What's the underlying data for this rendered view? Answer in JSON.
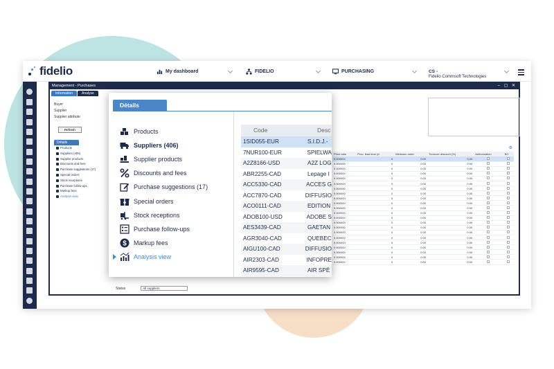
{
  "app": {
    "logo": "fidelio"
  },
  "topnav": {
    "dashboard": "My dashboard",
    "module": "FIDELIO",
    "purchasing": "PURCHASING",
    "user_code": "CS -",
    "user_company": "Fidelio Commsoft Technologies"
  },
  "window": {
    "title": "Management - Purchases",
    "tabs": [
      "Information",
      "Analyse"
    ],
    "filters": [
      "Buyer",
      "Supplier",
      "Supplier attribute"
    ],
    "refresh_label": "Refresh",
    "status_label": "Status",
    "status_value": "All suppliers"
  },
  "details": {
    "tab_label": "Détails",
    "items": [
      "Products",
      "Suppliers (406)",
      "Supplier products",
      "Discounts and fees",
      "Purchase suggestions (17)",
      "Special orders",
      "Stock receptions",
      "Purchase follow-ups",
      "Markup fees",
      "Analysis view"
    ]
  },
  "supplier_table": {
    "headers": [
      "Code",
      "Desc"
    ],
    "rows": [
      [
        "1SID055-EUR",
        "S.I.D.J.-"
      ],
      [
        "7NUR100-EUR",
        "SPIELWA"
      ],
      [
        "A2Z8166-USD",
        "A2Z LOG"
      ],
      [
        "ABR2255-CAD",
        "Lepage I"
      ],
      [
        "ACC5330-CAD",
        "ACCES G"
      ],
      [
        "ACC7870-CAD",
        "DIFFUSIO"
      ],
      [
        "ACO0111-CAD",
        "EDITION"
      ],
      [
        "ADOB100-USD",
        "ADOBE S"
      ],
      [
        "AES3439-CAD",
        "GAETAN"
      ],
      [
        "AGR3040-CAD",
        "QUEBEC"
      ],
      [
        "AIGU100-CAD",
        "DIFFUSIO"
      ],
      [
        "AIR2303-CAD",
        "INFOPRE"
      ],
      [
        "AIR9595-CAD",
        "AIR SPÉ"
      ]
    ]
  },
  "analysis_grid": {
    "headers": [
      "Price ratio",
      "Proc. lead time (d",
      "Minimum order",
      "Turnover discount (%)",
      "Authorization",
      "BO"
    ],
    "ratio": "0.000000",
    "lead": "0",
    "amount": "0.00",
    "row_count": 22
  }
}
